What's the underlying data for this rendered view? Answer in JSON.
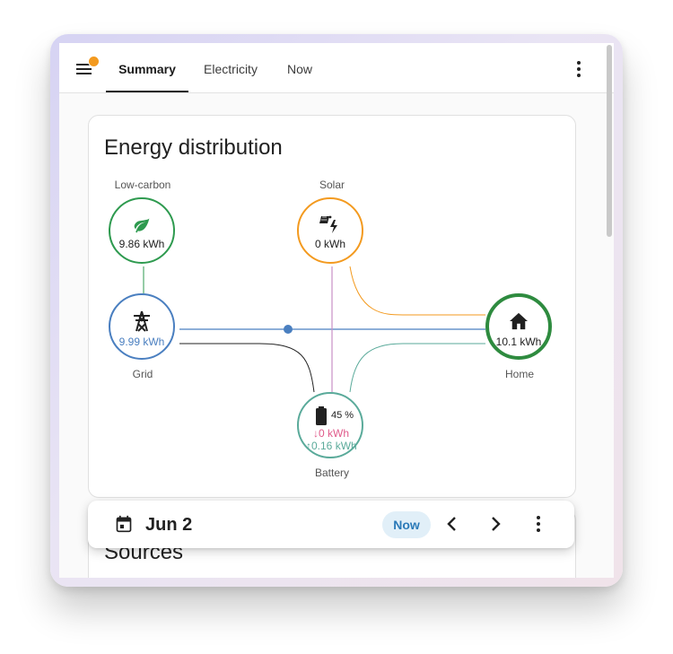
{
  "tabs": [
    {
      "label": "Summary",
      "active": true
    },
    {
      "label": "Electricity",
      "active": false
    },
    {
      "label": "Now",
      "active": false
    }
  ],
  "card": {
    "title": "Energy distribution"
  },
  "nodes": {
    "low_carbon": {
      "label": "Low-carbon",
      "value": "9.86 kWh",
      "icon": "leaf-icon",
      "color": "#2e9a4f"
    },
    "solar": {
      "label": "Solar",
      "value": "0 kWh",
      "icon": "solar-power-icon",
      "color": "#f39a1f"
    },
    "grid": {
      "label": "Grid",
      "value": "9.99 kWh",
      "icon": "transmission-tower-icon",
      "color": "#4a7fc0"
    },
    "home": {
      "label": "Home",
      "value": "10.1 kWh",
      "icon": "home-icon",
      "color": "#2e8b3f"
    },
    "battery": {
      "label": "Battery",
      "percent": "45 %",
      "charge_in": "0 kWh",
      "charge_out": "0.16 kWh",
      "icon": "battery-icon",
      "color": "#5aaa9a",
      "in_color": "#e05a8a",
      "out_color": "#5aaa9a"
    }
  },
  "sources_card": {
    "title": "Sources"
  },
  "date_bar": {
    "date": "Jun 2",
    "now_label": "Now"
  },
  "colors": {
    "accent_orange": "#f39a1f",
    "grid_blue": "#4a7fc0",
    "solar_orange": "#f39a1f",
    "battery_teal": "#5aaa9a",
    "solar_to_battery_pink": "#c98fc4"
  }
}
